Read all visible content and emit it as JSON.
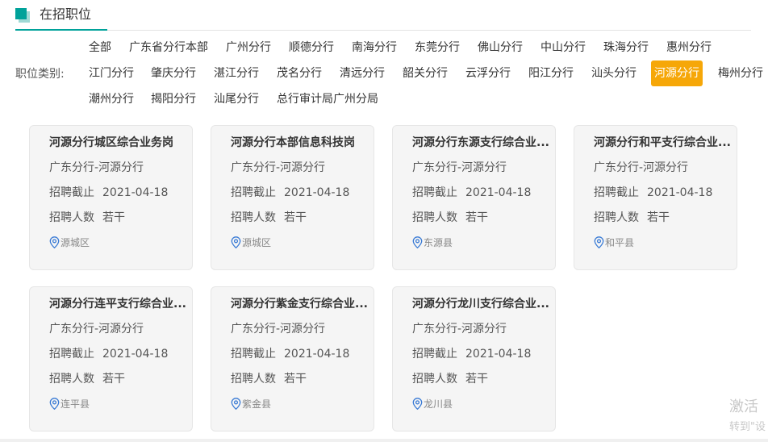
{
  "header": {
    "title": "在招职位"
  },
  "filters": {
    "label": "职位类别:",
    "rows": [
      [
        "全部",
        "广东省分行本部",
        "广州分行",
        "顺德分行",
        "南海分行",
        "东莞分行",
        "佛山分行",
        "中山分行",
        "珠海分行",
        "惠州分行"
      ],
      [
        "江门分行",
        "肇庆分行",
        "湛江分行",
        "茂名分行",
        "清远分行",
        "韶关分行",
        "云浮分行",
        "阳江分行",
        "汕头分行",
        "河源分行",
        "梅州分行"
      ],
      [
        "潮州分行",
        "揭阳分行",
        "汕尾分行",
        "总行审计局广州分局"
      ]
    ],
    "active": "河源分行",
    "active_color": "#f6a708"
  },
  "labels": {
    "deadline": "招聘截止",
    "headcount": "招聘人数"
  },
  "jobs": [
    {
      "title": "河源分行城区综合业务岗",
      "org": "广东分行-河源分行",
      "deadline": "2021-04-18",
      "headcount": "若干",
      "location": "源城区"
    },
    {
      "title": "河源分行本部信息科技岗",
      "org": "广东分行-河源分行",
      "deadline": "2021-04-18",
      "headcount": "若干",
      "location": "源城区"
    },
    {
      "title": "河源分行东源支行综合业...",
      "org": "广东分行-河源分行",
      "deadline": "2021-04-18",
      "headcount": "若干",
      "location": "东源县"
    },
    {
      "title": "河源分行和平支行综合业...",
      "org": "广东分行-河源分行",
      "deadline": "2021-04-18",
      "headcount": "若干",
      "location": "和平县"
    },
    {
      "title": "河源分行连平支行综合业...",
      "org": "广东分行-河源分行",
      "deadline": "2021-04-18",
      "headcount": "若干",
      "location": "连平县"
    },
    {
      "title": "河源分行紫金支行综合业...",
      "org": "广东分行-河源分行",
      "deadline": "2021-04-18",
      "headcount": "若干",
      "location": "紫金县"
    },
    {
      "title": "河源分行龙川支行综合业...",
      "org": "广东分行-河源分行",
      "deadline": "2021-04-18",
      "headcount": "若干",
      "location": "龙川县"
    }
  ],
  "watermark": {
    "line1": "激活",
    "line2": "转到\"设"
  },
  "colors": {
    "accent": "#00a29a",
    "pin": "#3a7bd5"
  }
}
